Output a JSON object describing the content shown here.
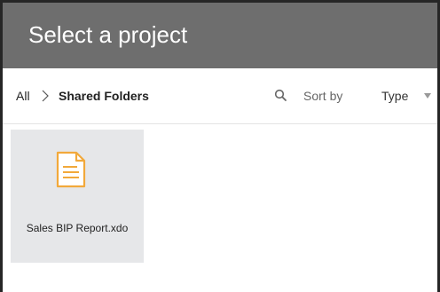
{
  "dialog": {
    "title": "Select a project"
  },
  "breadcrumb": {
    "root": "All",
    "current": "Shared Folders"
  },
  "toolbar": {
    "sort_label": "Sort by",
    "sort_value": "Type"
  },
  "items": [
    {
      "name": "Sales BIP Report.xdo",
      "icon": "document-icon"
    }
  ],
  "colors": {
    "title_bar": "#6e6e6e",
    "tile_background": "#e6e7e9",
    "icon_accent": "#f2a93b"
  }
}
